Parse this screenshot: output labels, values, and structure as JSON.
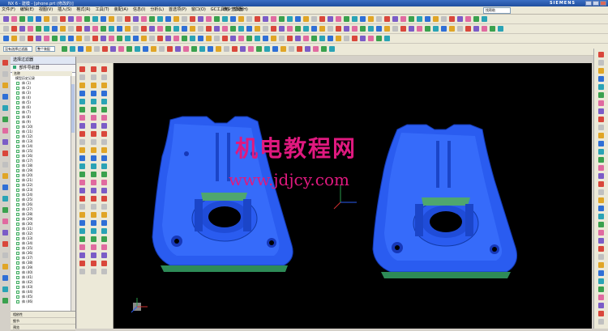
{
  "window": {
    "title": "NX 6 - 建模 - [phone.prt (修改的)]",
    "brand": "SIEMENS"
  },
  "menu": {
    "items": [
      "文件(F)",
      "编辑(E)",
      "视图(V)",
      "插入(S)",
      "格式(R)",
      "工具(T)",
      "装配(A)",
      "信息(I)",
      "分析(L)",
      "首选项(P)",
      "窗口(O)",
      "GC工具箱",
      "帮助(H)"
    ],
    "command_finder": "命令查找器",
    "help_search": "找帮助"
  },
  "selection_bar": {
    "filter_label": "没有选择过滤器",
    "scope_label": "整个装配"
  },
  "nav": {
    "header": "部件导航器",
    "tab_label": "选择过滤器",
    "column_name": "名称",
    "root": "模型历史记录",
    "items": [
      "体 (1)",
      "体 (2)",
      "体 (3)",
      "体 (4)",
      "体 (5)",
      "体 (6)",
      "体 (7)",
      "体 (8)",
      "体 (9)",
      "体 (10)",
      "体 (11)",
      "体 (12)",
      "体 (13)",
      "体 (14)",
      "体 (15)",
      "体 (16)",
      "体 (17)",
      "体 (18)",
      "体 (19)",
      "体 (20)",
      "体 (21)",
      "体 (22)",
      "体 (23)",
      "体 (24)",
      "体 (25)",
      "体 (26)",
      "体 (27)",
      "体 (28)",
      "体 (29)",
      "体 (30)",
      "体 (31)",
      "体 (32)",
      "体 (33)",
      "体 (34)",
      "体 (35)",
      "体 (36)",
      "体 (37)",
      "体 (38)",
      "体 (39)",
      "体 (40)",
      "体 (41)",
      "体 (42)",
      "体 (43)",
      "体 (44)",
      "体 (45)",
      "体 (46)"
    ],
    "bottom_panes": [
      "相依性",
      "细节",
      "预览"
    ]
  },
  "watermark": {
    "line1": "机电教程网",
    "line2": "www.jdjcy.com"
  },
  "colors": {
    "part_body": "#2a5cf0",
    "part_highlight": "#4a86ff",
    "part_base": "#2e8b57",
    "viewport_bg": "#000000",
    "watermark": "#e0197f"
  }
}
